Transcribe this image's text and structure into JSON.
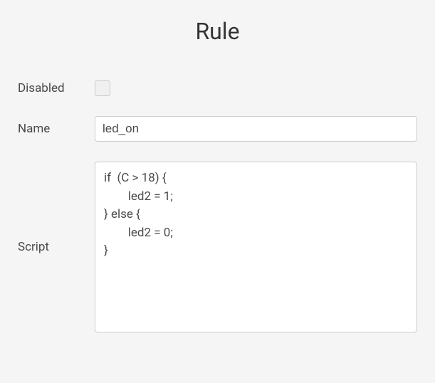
{
  "page": {
    "title": "Rule"
  },
  "form": {
    "disabled": {
      "label": "Disabled",
      "checked": false
    },
    "name": {
      "label": "Name",
      "value": "led_on"
    },
    "script": {
      "label": "Script",
      "value": "if  (C > 18) {\n        led2 = 1;\n} else {\n        led2 = 0;\n}"
    }
  }
}
